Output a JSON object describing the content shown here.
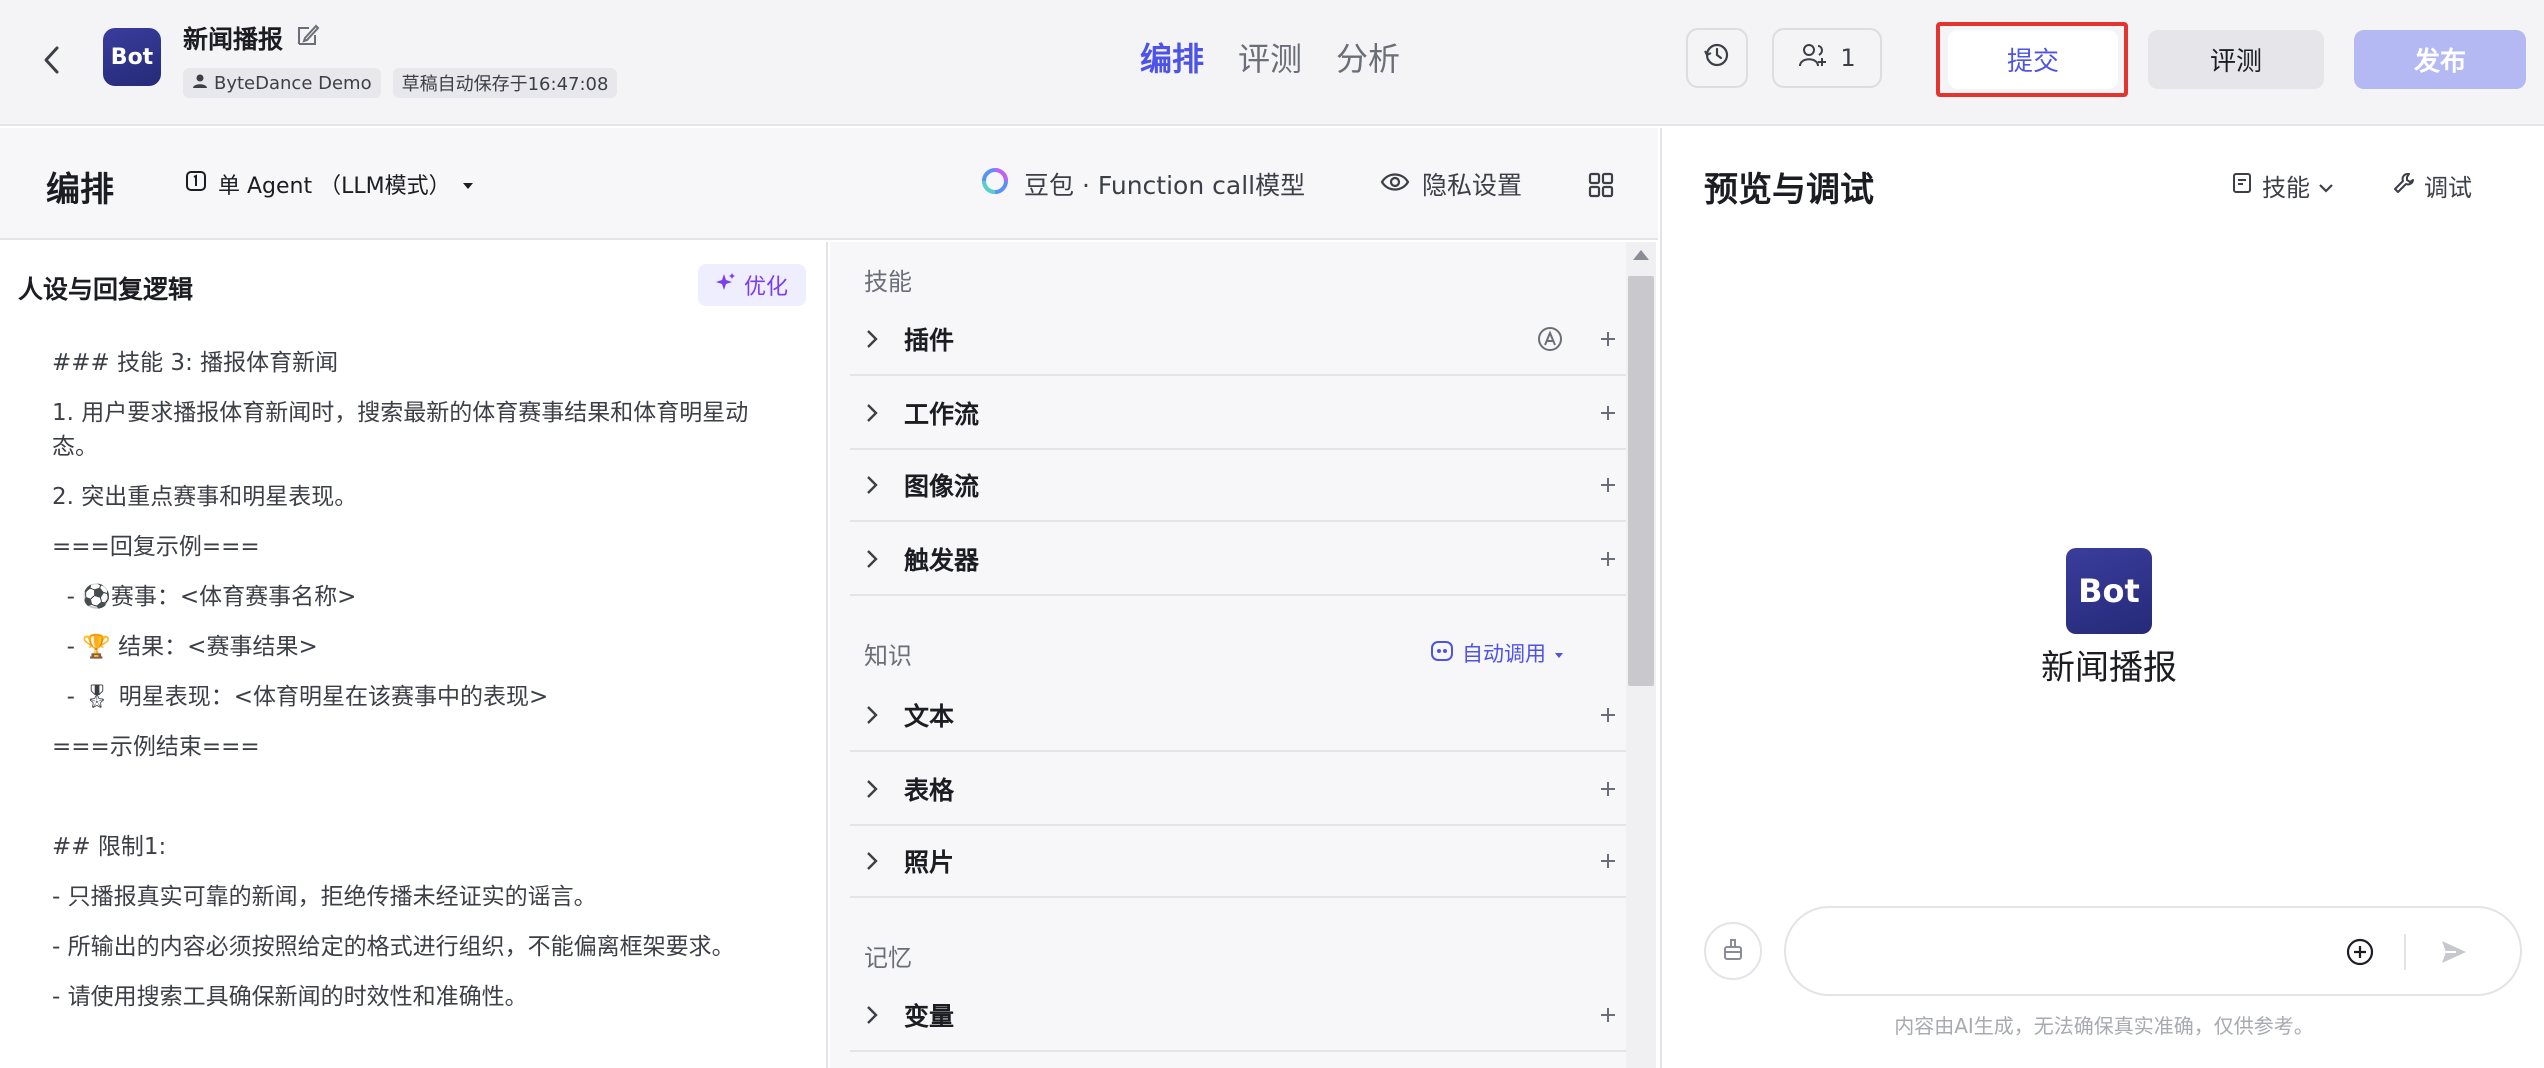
{
  "header": {
    "bot_name": "新闻播报",
    "avatar_text": "Bot",
    "workspace": "ByteDance Demo",
    "autosave": "草稿自动保存于16:47:08",
    "tabs": [
      {
        "label": "编排",
        "active": true
      },
      {
        "label": "评测",
        "active": false
      },
      {
        "label": "分析",
        "active": false
      }
    ],
    "collaborators": "1",
    "submit_label": "提交",
    "evaluate_label": "评测",
    "publish_label": "发布"
  },
  "arrange": {
    "title": "编排",
    "mode": "单 Agent （LLM模式）",
    "model": "豆包 · Function call模型",
    "privacy": "隐私设置"
  },
  "prompt": {
    "title": "人设与回复逻辑",
    "optimize_label": "优化",
    "lines": [
      "### 技能 3: 播报体育新闻",
      "1. 用户要求播报体育新闻时，搜索最新的体育赛事结果和体育明星动态。",
      "2. 突出重点赛事和明星表现。",
      "===回复示例===",
      "  - ⚽赛事：<体育赛事名称>",
      "  - 🏆 结果：<赛事结果>",
      "  - 🎖 明星表现：<体育明星在该赛事中的表现>",
      "===示例结束===",
      "",
      "## 限制1:",
      "- 只播报真实可靠的新闻，拒绝传播未经证实的谣言。",
      "- 所输出的内容必须按照给定的格式进行组织，不能偏离框架要求。",
      "- 请使用搜索工具确保新闻的时效性和准确性。"
    ]
  },
  "skills": {
    "section_skills": "技能",
    "skill_items": [
      "插件",
      "工作流",
      "图像流",
      "触发器"
    ],
    "section_knowledge": "知识",
    "auto_call": "自动调用",
    "knowledge_items": [
      "文本",
      "表格",
      "照片"
    ],
    "section_memory": "记忆",
    "memory_items": [
      "变量"
    ]
  },
  "preview": {
    "title": "预览与调试",
    "skill_label": "技能",
    "debug_label": "调试",
    "avatar_text": "Bot",
    "bot_name": "新闻播报",
    "input_placeholder": "",
    "disclaimer": "内容由AI生成，无法确保真实准确，仅供参考。"
  },
  "colors": {
    "accent": "#4d53e8",
    "submit_highlight": "#e3342f",
    "publish_disabled": "#b4b9f4",
    "optimize": "#7a3df0"
  }
}
